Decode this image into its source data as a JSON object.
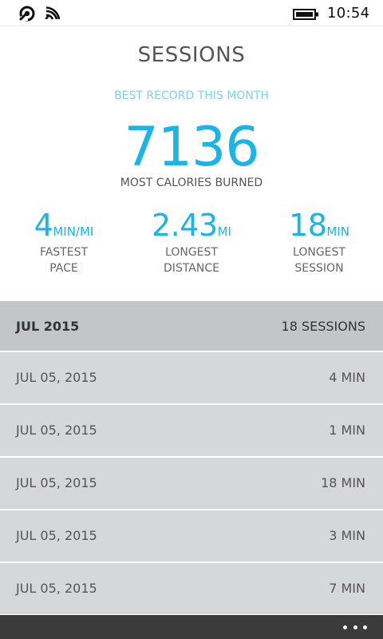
{
  "status_bar": {
    "icons": [
      "signal-icon",
      "wifi-icon",
      "battery-icon"
    ],
    "time": "10:54"
  },
  "page": {
    "title": "SESSIONS"
  },
  "best_record": {
    "label": "BEST RECORD THIS MONTH",
    "calories": "7136",
    "calories_label": "MOST CALORIES BURNED"
  },
  "stats": [
    {
      "value": "4",
      "unit": "MIN/MI",
      "label_line1": "FASTEST",
      "label_line2": "PACE"
    },
    {
      "value": "2.43",
      "unit": "MI",
      "label_line1": "LONGEST",
      "label_line2": "DISTANCE"
    },
    {
      "value": "18",
      "unit": "MIN",
      "label_line1": "LONGEST",
      "label_line2": "SESSION"
    }
  ],
  "sessions_list": {
    "header": {
      "month": "JUL 2015",
      "count": "18 SESSIONS"
    },
    "rows": [
      {
        "date": "JUL 05, 2015",
        "duration": "4 MIN"
      },
      {
        "date": "JUL 05, 2015",
        "duration": "1 MIN"
      },
      {
        "date": "JUL 05, 2015",
        "duration": "18 MIN"
      },
      {
        "date": "JUL 05, 2015",
        "duration": "3 MIN"
      },
      {
        "date": "JUL 05, 2015",
        "duration": "7 MIN"
      }
    ]
  },
  "app_bar": {
    "more_icon": "more-icon"
  },
  "colors": {
    "accent": "#18b5e6",
    "accent_light": "#7fd2ee",
    "header_row": "#c3c5c7",
    "list_row": "#d6d7d8",
    "app_bar": "#3b3b3b"
  }
}
